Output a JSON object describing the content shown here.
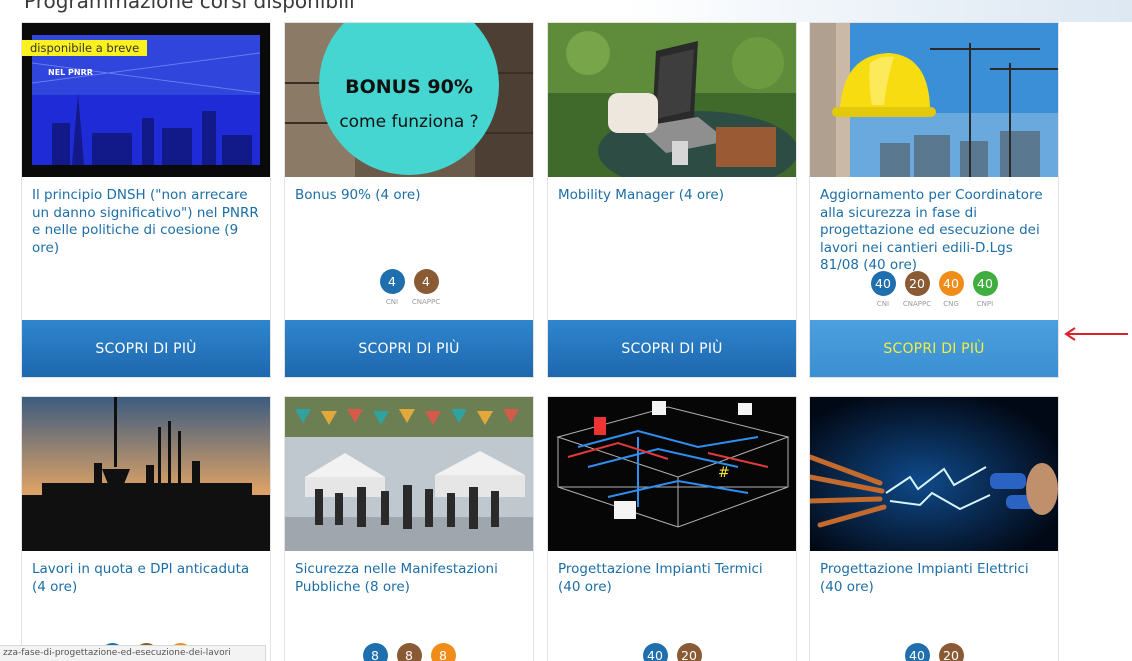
{
  "colors": {
    "title": "#1c6ea6",
    "cta": "#2066b0",
    "cta_hover_text": "#f1ef3e",
    "badge_cni": "#1f6fae",
    "badge_cnappc": "#8a5a34",
    "badge_cng": "#ef8c1a",
    "badge_cnpi": "#3fae3f",
    "soon_badge": "#fbf11e",
    "arrow": "#d9232a"
  },
  "header": {
    "cut_title": "Programmazione corsi disponibili"
  },
  "cards": [
    {
      "title": "Il principio DNSH (\"non arrecare un danno significativo\") nel PNRR e nelle politiche di coesione (9 ore)",
      "soon_label": "disponibile a breve",
      "image_caption": "NEL PNRR",
      "badges": [],
      "cta": "SCOPRI DI PIÙ"
    },
    {
      "title": "Bonus 90% (4 ore)",
      "image_caption": [
        "BONUS 90%",
        "come funziona ?"
      ],
      "badges": [
        {
          "value": "4",
          "label": "CNI"
        },
        {
          "value": "4",
          "label": "CNAPPC"
        }
      ],
      "cta": "SCOPRI DI PIÙ"
    },
    {
      "title": "Mobility Manager (4 ore)",
      "badges": [],
      "cta": "SCOPRI DI PIÙ"
    },
    {
      "title": "Aggiornamento per Coordinatore alla sicurezza in fase di progettazione ed esecuzione dei lavori nei cantieri edili-D.Lgs 81/08 (40 ore)",
      "badges": [
        {
          "value": "40",
          "label": "CNI"
        },
        {
          "value": "20",
          "label": "CNAPPC"
        },
        {
          "value": "40",
          "label": "CNG"
        },
        {
          "value": "40",
          "label": "CNPI"
        }
      ],
      "cta": "SCOPRI DI PIÙ"
    },
    {
      "title": "Lavori in quota e DPI anticaduta (4 ore)",
      "badges": [
        {
          "value": ""
        },
        {
          "value": ""
        },
        {
          "value": ""
        }
      ]
    },
    {
      "title": "Sicurezza nelle Manifestazioni Pubbliche (8 ore)",
      "badges": [
        {
          "value": "8"
        },
        {
          "value": "8"
        },
        {
          "value": "8"
        }
      ]
    },
    {
      "title": "Progettazione Impianti Termici (40 ore)",
      "badges": [
        {
          "value": "40"
        },
        {
          "value": "20"
        }
      ]
    },
    {
      "title": "Progettazione Impianti Elettrici (40 ore)",
      "badges": [
        {
          "value": "40"
        },
        {
          "value": "20"
        }
      ]
    }
  ],
  "status_bar": {
    "url": "zza-fase-di-progettazione-ed-esecuzione-dei-lavori"
  }
}
